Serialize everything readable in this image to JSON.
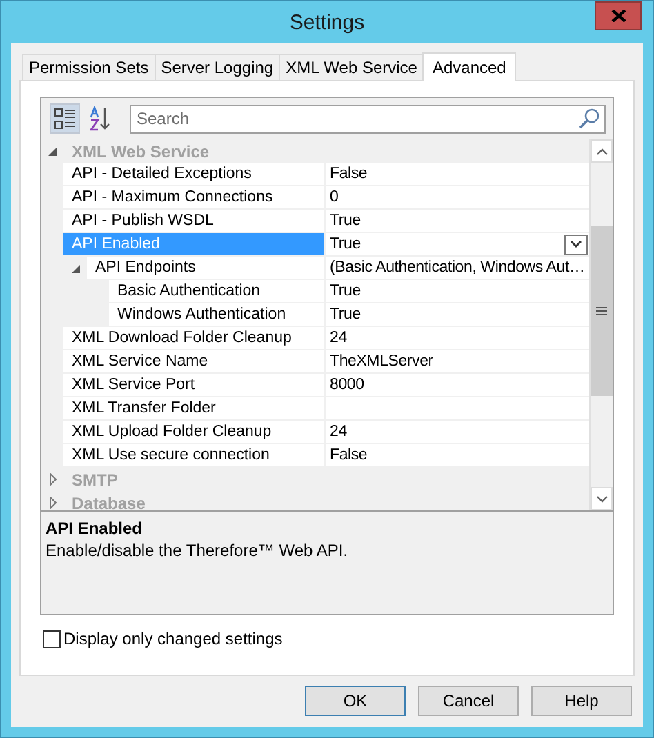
{
  "window": {
    "title": "Settings"
  },
  "tabs": [
    {
      "label": "Permission Sets",
      "selected": false
    },
    {
      "label": "Server Logging",
      "selected": false
    },
    {
      "label": "XML Web Service",
      "selected": false
    },
    {
      "label": "Advanced",
      "selected": true
    }
  ],
  "toolbar": {
    "categorized_selected": true,
    "alphabetical_selected": false
  },
  "search": {
    "placeholder": "Search"
  },
  "categories": [
    {
      "name": "XML Web Service",
      "expanded": true,
      "properties": [
        {
          "name": "API - Detailed Exceptions",
          "value": "False",
          "selected": false
        },
        {
          "name": "API - Maximum Connections",
          "value": "0",
          "selected": false
        },
        {
          "name": "API - Publish WSDL",
          "value": "True",
          "selected": false
        },
        {
          "name": "API Enabled",
          "value": "True",
          "selected": true
        },
        {
          "name": "API Endpoints",
          "value": "(Basic Authentication, Windows Aut…",
          "selected": false,
          "expanded": true,
          "children": [
            {
              "name": "Basic Authentication",
              "value": "True",
              "selected": false
            },
            {
              "name": "Windows Authentication",
              "value": "True",
              "selected": false
            }
          ]
        },
        {
          "name": "XML Download Folder Cleanup",
          "value": "24",
          "selected": false
        },
        {
          "name": "XML Service Name",
          "value": "TheXMLServer",
          "selected": false
        },
        {
          "name": "XML Service Port",
          "value": "8000",
          "selected": false
        },
        {
          "name": "XML Transfer Folder",
          "selected": false
        },
        {
          "name": "XML Upload Folder Cleanup",
          "value": "24",
          "selected": false
        },
        {
          "name": "XML Use secure connection",
          "value": "False",
          "selected": false
        }
      ]
    },
    {
      "name": "SMTP",
      "expanded": false
    },
    {
      "name": "Database",
      "expanded": false
    }
  ],
  "description": {
    "title": "API Enabled",
    "text": "Enable/disable the Therefore™ Web API."
  },
  "checkbox": {
    "label": "Display only changed settings",
    "checked": false
  },
  "buttons": [
    {
      "label": "OK",
      "default": true
    },
    {
      "label": "Cancel",
      "default": false
    },
    {
      "label": "Help",
      "default": false
    }
  ]
}
